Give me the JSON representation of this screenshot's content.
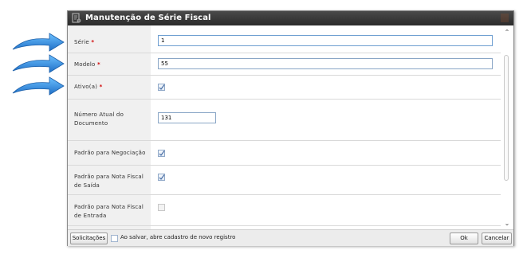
{
  "dialog": {
    "title": "Manutenção de Série Fiscal"
  },
  "form": {
    "serie": {
      "label": "Série",
      "required_mark": "*",
      "value": "1"
    },
    "modelo": {
      "label": "Modelo",
      "required_mark": "*",
      "value": "55"
    },
    "ativo": {
      "label": "Ativo(a)",
      "required_mark": "*",
      "checked": true
    },
    "numero_atual": {
      "label_line1": "Número Atual do",
      "label_line2": "Documento",
      "value": "131"
    },
    "padrao_negociacao": {
      "label": "Padrão para Negociação",
      "checked": true
    },
    "padrao_nf_saida": {
      "label_line1": "Padrão para Nota Fiscal",
      "label_line2": "de Saída",
      "checked": true
    },
    "padrao_nf_entrada": {
      "label_line1": "Padrão para Nota Fiscal",
      "label_line2": "de Entrada",
      "checked": false
    }
  },
  "footer": {
    "solicitacoes_label": "Solicitações",
    "novo_registro_text": "Ao salvar, abre cadastro de novo registro",
    "ok_label": "Ok",
    "cancelar_label": "Cancelar"
  },
  "colors": {
    "titlebar": "#2b2b2b",
    "required": "#d00000",
    "arrow": "#2f8fe0",
    "input_border": "#6f9fd1"
  }
}
